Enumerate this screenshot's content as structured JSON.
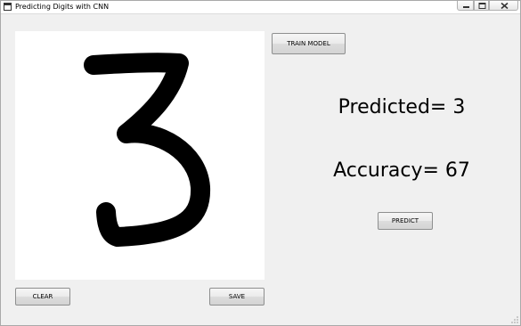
{
  "window": {
    "title": "Predicting Digits with CNN"
  },
  "icons": {
    "app": "app-window-icon",
    "minimize": "minimize-icon",
    "maximize": "maximize-icon",
    "close": "close-icon",
    "resize": "resize-grip-icon"
  },
  "canvas": {
    "drawn_digit": "3",
    "background": "#ffffff",
    "stroke_color": "#000000"
  },
  "buttons": {
    "train": "TRAIN MODEL",
    "predict": "PREDICT",
    "clear": "CLEAR",
    "save": "SAVE"
  },
  "results": {
    "predicted": "Predicted= 3",
    "accuracy": "Accuracy= 67"
  }
}
